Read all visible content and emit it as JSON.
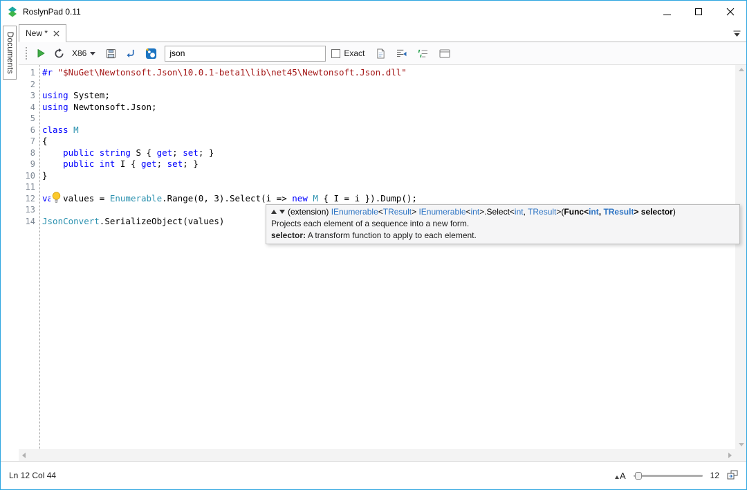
{
  "window": {
    "title": "RoslynPad 0.11"
  },
  "sidebar": {
    "documents_label": "Documents"
  },
  "tab_bar": {
    "active_tab": "New *"
  },
  "toolbar": {
    "platform": "X86",
    "search_value": "json",
    "exact_label": "Exact"
  },
  "editor": {
    "lines": [
      {
        "n": "1",
        "segs": [
          {
            "t": "#r ",
            "c": "k"
          },
          {
            "t": "\"$NuGet\\Newtonsoft.Json\\10.0.1-beta1\\lib\\net45\\Newtonsoft.Json.dll\"",
            "c": "s"
          }
        ]
      },
      {
        "n": "2",
        "segs": []
      },
      {
        "n": "3",
        "segs": [
          {
            "t": "using",
            "c": "k"
          },
          {
            "t": " System;",
            "c": "p"
          }
        ]
      },
      {
        "n": "4",
        "segs": [
          {
            "t": "using",
            "c": "k"
          },
          {
            "t": " Newtonsoft.Json;",
            "c": "p"
          }
        ]
      },
      {
        "n": "5",
        "segs": []
      },
      {
        "n": "6",
        "segs": [
          {
            "t": "class",
            "c": "k"
          },
          {
            "t": " ",
            "c": "p"
          },
          {
            "t": "M",
            "c": "t"
          }
        ]
      },
      {
        "n": "7",
        "segs": [
          {
            "t": "{",
            "c": "p"
          }
        ]
      },
      {
        "n": "8",
        "segs": [
          {
            "t": "    ",
            "c": "p"
          },
          {
            "t": "public",
            "c": "k"
          },
          {
            "t": " ",
            "c": "p"
          },
          {
            "t": "string",
            "c": "k"
          },
          {
            "t": " S { ",
            "c": "p"
          },
          {
            "t": "get",
            "c": "k"
          },
          {
            "t": "; ",
            "c": "p"
          },
          {
            "t": "set",
            "c": "k"
          },
          {
            "t": "; }",
            "c": "p"
          }
        ]
      },
      {
        "n": "9",
        "segs": [
          {
            "t": "    ",
            "c": "p"
          },
          {
            "t": "public",
            "c": "k"
          },
          {
            "t": " ",
            "c": "p"
          },
          {
            "t": "int",
            "c": "k"
          },
          {
            "t": " I { ",
            "c": "p"
          },
          {
            "t": "get",
            "c": "k"
          },
          {
            "t": "; ",
            "c": "p"
          },
          {
            "t": "set",
            "c": "k"
          },
          {
            "t": "; }",
            "c": "p"
          }
        ]
      },
      {
        "n": "10",
        "segs": [
          {
            "t": "}",
            "c": "p"
          }
        ]
      },
      {
        "n": "11",
        "segs": []
      },
      {
        "n": "12",
        "segs": [
          {
            "t": "var",
            "c": "k"
          },
          {
            "t": " values = ",
            "c": "p"
          },
          {
            "t": "Enumerable",
            "c": "t"
          },
          {
            "t": ".Range(0, 3).Select(i => ",
            "c": "p"
          },
          {
            "t": "new",
            "c": "k"
          },
          {
            "t": " ",
            "c": "p"
          },
          {
            "t": "M",
            "c": "t"
          },
          {
            "t": " { I = i }).Dump();",
            "c": "p"
          }
        ]
      },
      {
        "n": "13",
        "segs": []
      },
      {
        "n": "14",
        "segs": [
          {
            "t": "JsonConvert",
            "c": "t"
          },
          {
            "t": ".SerializeObject(values)",
            "c": "p"
          }
        ]
      }
    ]
  },
  "tooltip": {
    "signature": [
      {
        "t": "(extension) ",
        "c": "p"
      },
      {
        "t": "IEnumerable",
        "c": "t"
      },
      {
        "t": "<",
        "c": "p"
      },
      {
        "t": "TResult",
        "c": "t"
      },
      {
        "t": "> ",
        "c": "p"
      },
      {
        "t": "IEnumerable",
        "c": "t"
      },
      {
        "t": "<",
        "c": "p"
      },
      {
        "t": "int",
        "c": "t"
      },
      {
        "t": ">.Select<",
        "c": "p"
      },
      {
        "t": "int",
        "c": "t"
      },
      {
        "t": ", ",
        "c": "p"
      },
      {
        "t": "TResult",
        "c": "t"
      },
      {
        "t": ">(",
        "c": "p"
      },
      {
        "t": "Func",
        "c": "pb"
      },
      {
        "t": "<",
        "c": "pb"
      },
      {
        "t": "int",
        "c": "tb"
      },
      {
        "t": ", ",
        "c": "pb"
      },
      {
        "t": "TResult",
        "c": "tb"
      },
      {
        "t": "> ",
        "c": "pb"
      },
      {
        "t": "selector",
        "c": "pb"
      },
      {
        "t": ")",
        "c": "p"
      }
    ],
    "description": "Projects each element of a sequence into a new form.",
    "param_label": "selector:",
    "param_text": " A transform function to apply to each element."
  },
  "status_bar": {
    "caret_position": "Ln 12 Col 44",
    "font_size_icon": "A",
    "font_size": "12"
  },
  "icons": {
    "run": "green-play-triangle",
    "restart_host": "circular-arrow",
    "platform_chevron": "chevron-down",
    "save": "floppy-disk",
    "open_result": "blue-return-arrow",
    "nuget": "blue-square-with-dots",
    "lightbulb": "yellow-bulb-suggestion",
    "document_dropdown": "list-chevron"
  },
  "colors": {
    "window_border": "#2da5e0",
    "keyword": "#0000ff",
    "type": "#2b91af",
    "string": "#a31515",
    "run_green": "#3fae46",
    "nuget_blue": "#1b74c2"
  }
}
